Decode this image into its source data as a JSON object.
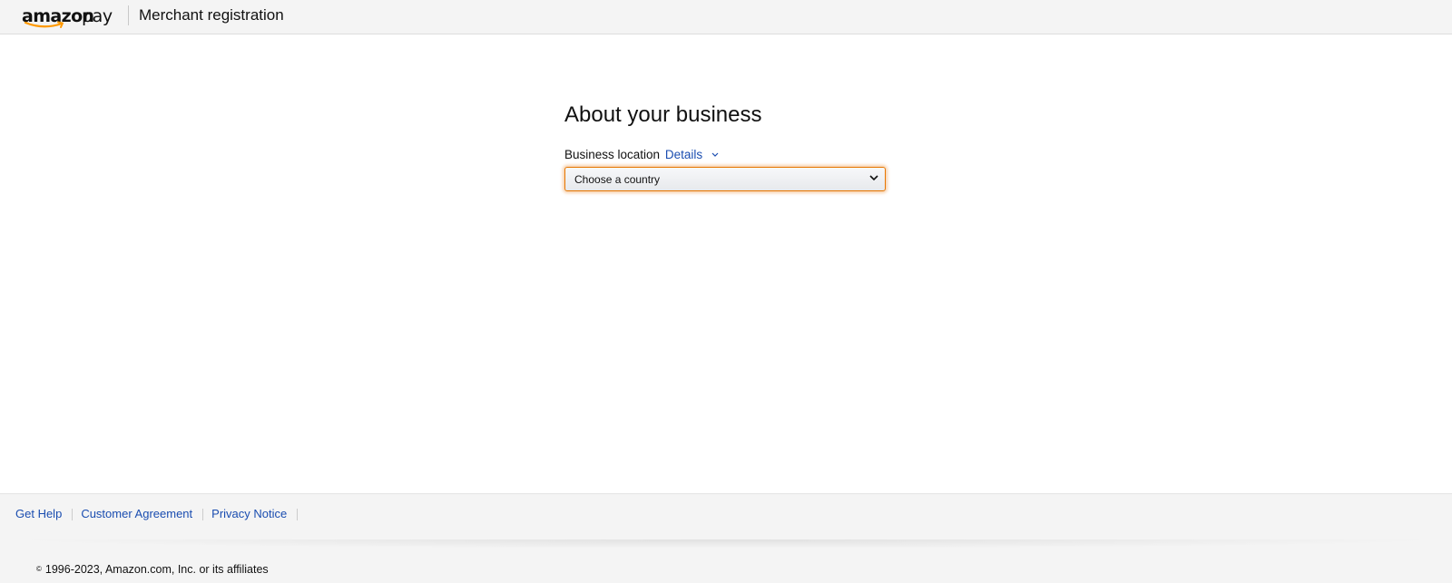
{
  "header": {
    "logo_amazon": "amazon",
    "logo_pay": "pay",
    "title": "Merchant registration"
  },
  "main": {
    "title": "About your business",
    "field_label": "Business location",
    "details_link": "Details",
    "select_value": "Choose a country"
  },
  "footer": {
    "links": [
      "Get Help",
      "Customer Agreement",
      "Privacy Notice"
    ],
    "copyright_mark": "©",
    "copyright": "1996-2023, Amazon.com, Inc. or its affiliates"
  },
  "colors": {
    "accent_link": "#1a4db0",
    "focus_border": "#e77600",
    "logo_smile": "#ff9900"
  },
  "icons": [
    "amazon-smile-icon",
    "chevron-down-icon",
    "dropdown-arrow-icon"
  ]
}
